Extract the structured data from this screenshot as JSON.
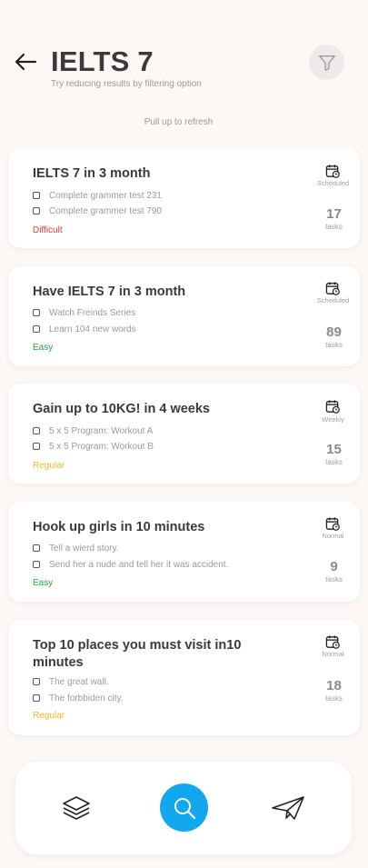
{
  "header": {
    "title": "IELTS 7",
    "subtitle": "Try reducing results by filtering option"
  },
  "refresh_hint": "Pull up to refresh",
  "cards": [
    {
      "title": "IELTS 7 in 3 month",
      "tasks": [
        "Complete grammer test 231",
        "Complete grammer test 790"
      ],
      "difficulty": "Difficult",
      "difficulty_color": "#e53935",
      "type": "Scheduled",
      "count": "17",
      "count_label": "tasks"
    },
    {
      "title": "Have IELTS 7 in 3 month",
      "tasks": [
        "Watch Freinds Series",
        "Learn 104 new words"
      ],
      "difficulty": "Easy",
      "difficulty_color": "#22a83a",
      "type": "Scheduled",
      "count": "89",
      "count_label": "tasks"
    },
    {
      "title": "Gain up to 10KG! in 4 weeks",
      "tasks": [
        "5 x 5 Program: Workout A",
        "5 x 5 Program: Workout B"
      ],
      "difficulty": "Regular",
      "difficulty_color": "#f2b824",
      "type": "Weekly",
      "count": "15",
      "count_label": "tasks"
    },
    {
      "title": "Hook up girls in 10 minutes",
      "tasks": [
        "Tell a wierd story.",
        "Send her a nude and tell her it was accident."
      ],
      "difficulty": "Easy",
      "difficulty_color": "#22a83a",
      "type": "Normal",
      "count": "9",
      "count_label": "tasks"
    },
    {
      "title": "Top 10 places you must visit in10 minutes",
      "tasks": [
        "The great wall.",
        "The forbbiden city."
      ],
      "difficulty": "Regular",
      "difficulty_color": "#f2b824",
      "type": "Normal",
      "count": "18",
      "count_label": "tasks"
    }
  ],
  "nav": {
    "items": [
      "layers-icon",
      "search-icon",
      "send-icon"
    ],
    "active_color": "#11a8ef"
  }
}
